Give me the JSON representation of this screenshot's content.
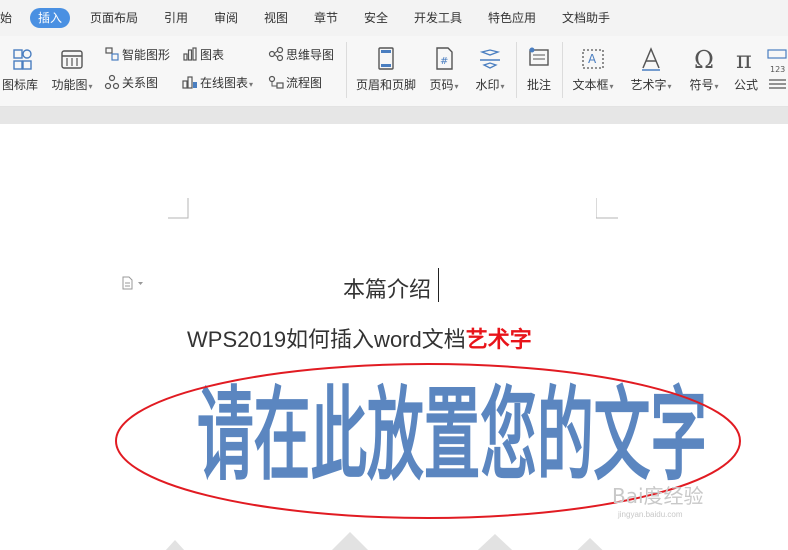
{
  "menubar": {
    "tabs": [
      "始",
      "插入",
      "页面布局",
      "引用",
      "审阅",
      "视图",
      "章节",
      "安全",
      "开发工具",
      "特色应用",
      "文档助手"
    ],
    "active_tab": "插入"
  },
  "ribbon": {
    "icon_library": "图标库",
    "function_chart": "功能图",
    "smart_graphic": "智能图形",
    "chart": "图表",
    "relation_chart": "关系图",
    "online_chart": "在线图表",
    "mind_map": "思维导图",
    "flowchart": "流程图",
    "header_footer": "页眉和页脚",
    "page_number": "页码",
    "watermark": "水印",
    "comment": "批注",
    "text_box": "文本框",
    "word_art": "艺术字",
    "symbol": "符号",
    "formula": "公式"
  },
  "document": {
    "title": "本篇介绍",
    "subtitle_prefix": "WPS2019如何插入word文档",
    "subtitle_highlight": "艺术字",
    "word_art_text": "请在此放置您的文字"
  },
  "watermark": {
    "logo": "Bai度经验",
    "url": "jingyan.baidu.com"
  },
  "colors": {
    "active_tab": "#4a90e2",
    "highlight": "#e8141a",
    "word_art": "#5b86c0",
    "ellipse": "#e11b22"
  }
}
